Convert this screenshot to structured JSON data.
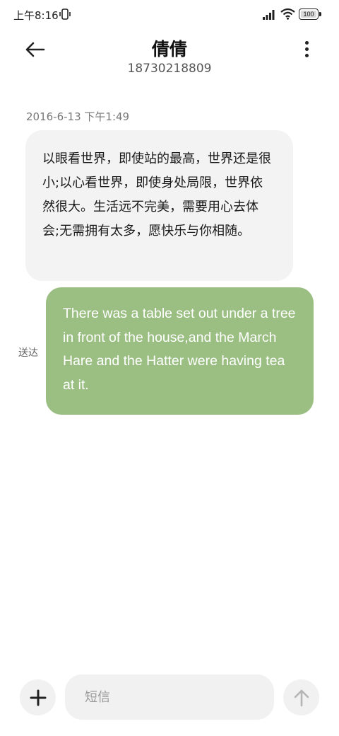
{
  "status_bar": {
    "time": "上午8:16",
    "battery": "100",
    "battery_level": 1.0
  },
  "header": {
    "contact_name": "倩倩",
    "contact_number": "18730218809"
  },
  "conversation": {
    "timestamp": "2016-6-13 下午1:49",
    "received_message": "以眼看世界，即使站的最高，世界还是很小;以心看世界，即使身处局限，世界依然很大。生活远不完美，需要用心去体会;无需拥有太多，愿快乐与你相随。",
    "sent_message": "There was a table set out under a tree in front of the house,and the March Hare and the Hatter were having tea at it.",
    "sent_status": "送达"
  },
  "composer": {
    "placeholder": "短信",
    "value": ""
  },
  "icons": {
    "back": "arrow-left-icon",
    "more": "more-vertical-icon",
    "add": "plus-icon",
    "send": "arrow-up-icon",
    "signal": "signal-icon",
    "wifi": "wifi-icon",
    "vibrate": "vibrate-icon"
  },
  "colors": {
    "sent_bubble": "#9bbf83",
    "received_bubble": "#f3f3f3",
    "composer_bg": "#f1f1f1"
  }
}
